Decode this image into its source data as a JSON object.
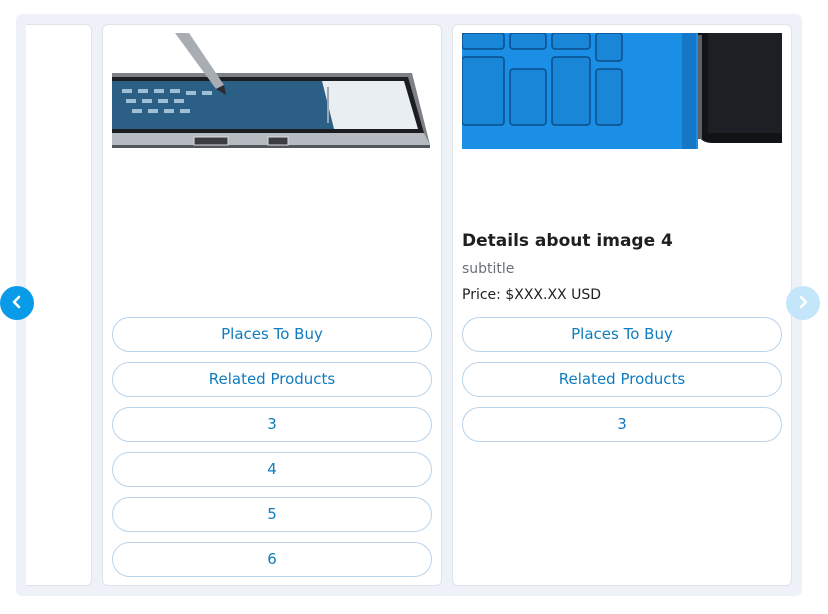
{
  "colors": {
    "accent": "#0a9be8",
    "button_text": "#0f7cc0",
    "button_border": "#b9d3ea",
    "carousel_bg": "#eef1f7"
  },
  "carousel": {
    "prev_icon": "chevron-left-icon",
    "next_icon": "chevron-right-icon",
    "cards": [
      {
        "image_icon": "tablet-cover-image"
      },
      {
        "image_icon": "tablet-pen-image",
        "buttons": [
          "Places To Buy",
          "Related Products",
          "3",
          "4",
          "5",
          "6"
        ]
      },
      {
        "image_icon": "keyboard-cover-image",
        "title": "Details about image 4",
        "subtitle": "subtitle",
        "price": "Price: $XXX.XX USD",
        "buttons": [
          "Places To Buy",
          "Related Products",
          "3"
        ]
      }
    ]
  }
}
